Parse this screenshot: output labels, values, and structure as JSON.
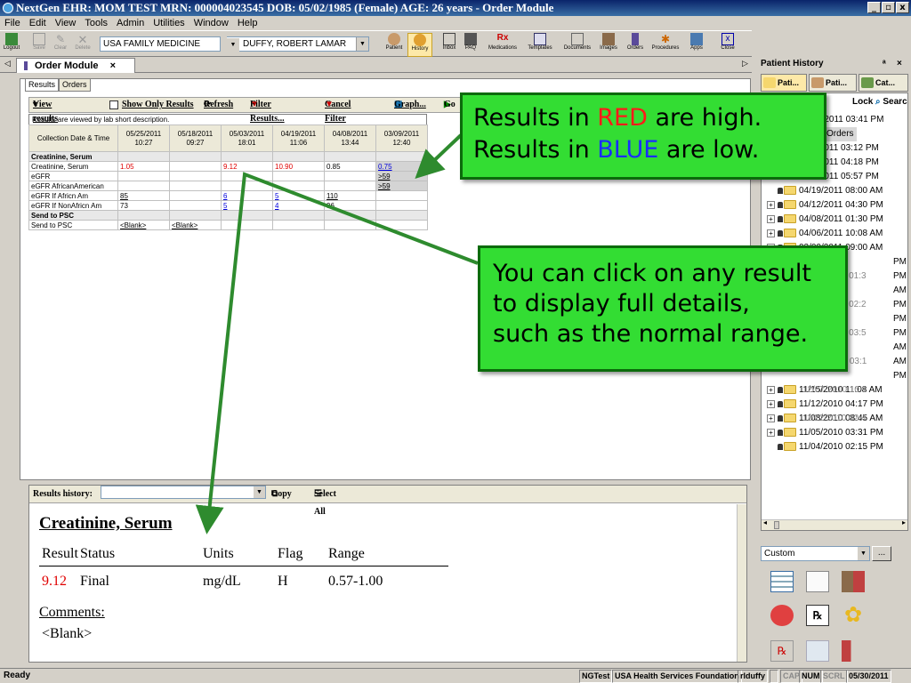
{
  "window": {
    "title": "NextGen EHR: MOM TEST  MRN: 000004023545  DOB: 05/02/1985  (Female)  AGE: 26 years  - Order Module"
  },
  "menu": [
    "File",
    "Edit",
    "View",
    "Tools",
    "Admin",
    "Utilities",
    "Window",
    "Help"
  ],
  "toolbar": {
    "left_buttons": [
      "Logout",
      "Save",
      "Clear",
      "Delete"
    ],
    "practice": "USA FAMILY MEDICINE",
    "provider": "DUFFY, ROBERT LAMAR",
    "right_buttons": [
      "Patient",
      "History",
      "Inbox",
      "PAQ",
      "Medications",
      "Templates",
      "Documents",
      "Images",
      "Orders",
      "Procedures",
      "Apps",
      "Close"
    ]
  },
  "doc_tab": {
    "label": "Order Module",
    "close": "×"
  },
  "subtabs": [
    "Results",
    "Orders"
  ],
  "results_toolbar": {
    "view_by": "View results by",
    "show_only": "Show Only Results",
    "refresh": "Refresh",
    "filter": "Filter Results...",
    "cancel_filter": "Cancel Filter",
    "graph": "Graph...",
    "go": "Go"
  },
  "viewed_note": "Results are viewed by lab short description.",
  "grid": {
    "corner": "Collection Date & Time",
    "columns": [
      {
        "date": "05/25/2011",
        "time": "10:27"
      },
      {
        "date": "05/18/2011",
        "time": "09:27"
      },
      {
        "date": "05/03/2011",
        "time": "18:01"
      },
      {
        "date": "04/19/2011",
        "time": "11:06"
      },
      {
        "date": "04/08/2011",
        "time": "13:44"
      },
      {
        "date": "03/09/2011",
        "time": "12:40"
      }
    ],
    "rows": [
      {
        "label": "Creatinine, Serum",
        "group": true,
        "cells": [
          "",
          "",
          "",
          "",
          "",
          ""
        ]
      },
      {
        "label": "Creatinine, Serum",
        "cells": [
          "1.05",
          "",
          "9.12",
          "10.90",
          "0.85",
          "0.75"
        ],
        "flags": [
          "high",
          "",
          "high",
          "high",
          "",
          "low"
        ]
      },
      {
        "label": "eGFR",
        "cells": [
          "",
          "",
          "",
          "",
          "",
          ">59"
        ],
        "flags": [
          "",
          "",
          "",
          "",
          "",
          "link"
        ]
      },
      {
        "label": "eGFR AfricanAmerican",
        "cells": [
          "",
          "",
          "",
          "",
          "",
          ">59"
        ],
        "flags": [
          "",
          "",
          "",
          "",
          "",
          "link"
        ]
      },
      {
        "label": "eGFR If Africn Am",
        "cells": [
          "85",
          "",
          "6",
          "5",
          "110",
          ""
        ],
        "flags": [
          "link",
          "",
          "low",
          "low",
          "link",
          ""
        ]
      },
      {
        "label": "eGFR If NonAfricn Am",
        "cells": [
          "73",
          "",
          "5",
          "4",
          "96",
          ""
        ],
        "flags": [
          "",
          "",
          "low",
          "low",
          "",
          ""
        ]
      },
      {
        "label": "Send to PSC",
        "group": true,
        "cells": [
          "",
          "",
          "",
          "",
          "",
          ""
        ]
      },
      {
        "label": "Send to PSC",
        "cells": [
          "<Blank>",
          "<Blank>",
          "",
          "",
          "",
          ""
        ],
        "flags": [
          "link",
          "link",
          "",
          "",
          "",
          ""
        ]
      }
    ]
  },
  "history": {
    "label": "Results history:",
    "copy": "Copy",
    "select_all": "Select All",
    "title": "Creatinine, Serum",
    "headers": [
      "Result",
      "Status",
      "Units",
      "Flag",
      "Range"
    ],
    "values": [
      "9.12",
      "Final",
      "mg/dL",
      "H",
      "0.57-1.00"
    ],
    "comments_label": "Comments:",
    "comments": "<Blank>"
  },
  "right_panel": {
    "title": "Patient History",
    "pin": "ᵃ",
    "close": "×",
    "tabs": [
      "Pati...",
      "Pati...",
      "Cat..."
    ],
    "tools": [
      "Lock",
      "Search"
    ],
    "tree_top": [
      {
        "text": "5/2011 03:41 PM"
      },
      {
        "text": "Orders"
      },
      {
        "text": "/2011 03:12 PM"
      },
      {
        "text": "/2011 04:18 PM"
      },
      {
        "text": "/2011 05:57 PM"
      }
    ],
    "tree": [
      "04/19/2011 08:00 AM",
      "04/12/2011 04:30 PM",
      "04/08/2011 01:30 PM",
      "04/06/2011 10:08 AM",
      "03/09/2011 09:00 AM",
      "11/15/2010 11:08 AM",
      "11/12/2010 04:17 PM",
      "11/08/2010 08:45 AM",
      "11/05/2010 03:31 PM",
      "11/04/2010 02:15 PM"
    ],
    "partial_right": [
      "PM",
      "PM",
      "AM",
      "PM",
      "PM",
      "PM",
      "AM",
      "AM",
      "PM"
    ],
    "partial_left": [
      "03/08/2011 01:3",
      "01/14/2011 02:2",
      "01/10/2011 03:5",
      "12/21/2010 03:1",
      "12/07/2010 10:1",
      "11/22/2010 02:4"
    ],
    "filter": "Custom",
    "filter_btn": "..."
  },
  "status": {
    "left": "Ready",
    "cells": [
      "NGTest",
      "USA Health Services Foundation",
      "rlduffy",
      "",
      "CAP",
      "NUM",
      "SCRL",
      "05/30/2011"
    ]
  },
  "callouts": {
    "c1_line1": [
      "Results in ",
      "RED",
      " are high."
    ],
    "c1_line2": [
      "Results in ",
      "BLUE",
      " are low."
    ],
    "c2": [
      "You can click on any result",
      "to display full details,",
      "such as the normal range."
    ]
  },
  "colors": {
    "callout_bg": "#33dd33",
    "high": "#e00000",
    "low": "#0000dd",
    "arrow": "#2e8b2e"
  }
}
